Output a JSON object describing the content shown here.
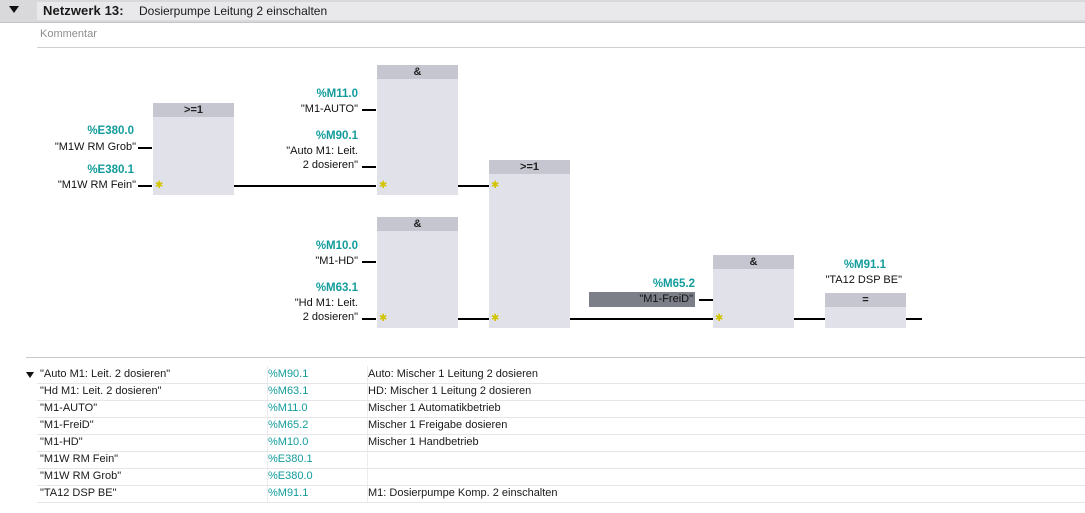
{
  "network": {
    "label": "Netzwerk 13:",
    "title": "Dosierpumpe Leitung 2 einschalten",
    "comment_placeholder": "Kommentar"
  },
  "blocks": {
    "or1": ">=1",
    "and1": "&",
    "and2": "&",
    "or2": ">=1",
    "and3": "&",
    "assign": "="
  },
  "operands": {
    "e3800": {
      "addr": "%E380.0",
      "sym": "\"M1W RM Grob\""
    },
    "e3801": {
      "addr": "%E380.1",
      "sym": "\"M1W RM Fein\""
    },
    "m110": {
      "addr": "%M11.0",
      "sym": "\"M1-AUTO\""
    },
    "m901": {
      "addr": "%M90.1",
      "sym1": "\"Auto M1: Leit.",
      "sym2": "2 dosieren\""
    },
    "m100": {
      "addr": "%M10.0",
      "sym": "\"M1-HD\""
    },
    "m631": {
      "addr": "%M63.1",
      "sym1": "\"Hd M1: Leit.",
      "sym2": "2 dosieren\""
    },
    "m652": {
      "addr": "%M65.2",
      "sym": "\"M1-FreiD\""
    },
    "m911": {
      "addr": "%M91.1",
      "sym": "\"TA12 DSP BE\""
    }
  },
  "table": [
    {
      "name": "\"Auto M1: Leit. 2 dosieren\"",
      "addr": "%M90.1",
      "comment": "Auto: Mischer 1 Leitung  2 dosieren"
    },
    {
      "name": "\"Hd M1: Leit. 2 dosieren\"",
      "addr": "%M63.1",
      "comment": "HD: Mischer 1 Leitung  2 dosieren"
    },
    {
      "name": "\"M1-AUTO\"",
      "addr": "%M11.0",
      "comment": "Mischer 1 Automatikbetrieb"
    },
    {
      "name": "\"M1-FreiD\"",
      "addr": "%M65.2",
      "comment": "Mischer 1 Freigabe dosieren"
    },
    {
      "name": "\"M1-HD\"",
      "addr": "%M10.0",
      "comment": "Mischer 1 Handbetrieb"
    },
    {
      "name": "\"M1W RM Fein\"",
      "addr": "%E380.1",
      "comment": ""
    },
    {
      "name": "\"M1W RM Grob\"",
      "addr": "%E380.0",
      "comment": ""
    },
    {
      "name": "\"TA12 DSP BE\"",
      "addr": "%M91.1",
      "comment": "M1: Dosierpumpe Komp. 2 einschalten"
    }
  ],
  "colors": {
    "address": "#139c9c",
    "block_body": "#e1e2e9",
    "block_head": "#c5c6d0",
    "selected_operand": "#7c7f88",
    "header_bg": "#d9d9dc"
  },
  "icons": {
    "collapse": "triangle-down-icon",
    "negation_star": "yellow-star-icon"
  }
}
